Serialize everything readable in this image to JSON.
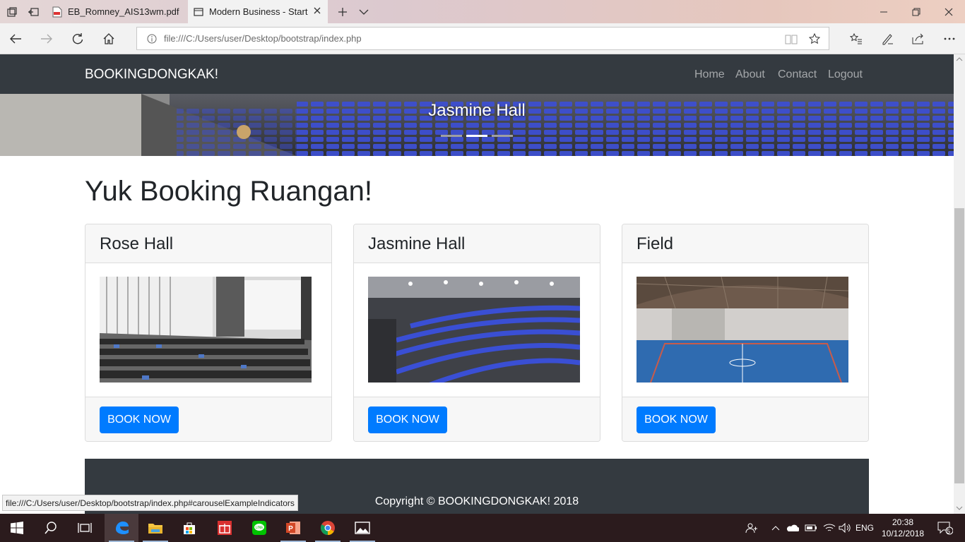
{
  "browser": {
    "tabs": [
      {
        "label": "EB_Romney_AIS13wm.pdf",
        "icon": "pdf-icon"
      },
      {
        "label": "Modern Business - Start",
        "icon": "page-icon",
        "active": true
      }
    ],
    "address": "file:///C:/Users/user/Desktop/bootstrap/index.php",
    "status_url": "file:///C:/Users/user/Desktop/bootstrap/index.php#carouselExampleIndicators"
  },
  "site": {
    "brand": "BOOKINGDONGKAK!",
    "nav": [
      "Home",
      "About",
      "Contact",
      "Logout"
    ],
    "carousel": {
      "caption": "Jasmine Hall",
      "active_index": 1,
      "count": 3
    },
    "heading": "Yuk Booking Ruangan!",
    "cards": [
      {
        "title": "Rose Hall",
        "button": "BOOK NOW"
      },
      {
        "title": "Jasmine Hall",
        "button": "BOOK NOW"
      },
      {
        "title": "Field",
        "button": "BOOK NOW"
      }
    ],
    "footer": "Copyright © BOOKINGDONGKAK! 2018"
  },
  "taskbar": {
    "language": "ENG",
    "time": "20:38",
    "date": "10/12/2018",
    "notifications": "5",
    "apps": [
      "windows-icon",
      "search-icon",
      "task-view-icon",
      "edge-icon",
      "file-explorer-icon",
      "store-icon",
      "gift-icon",
      "line-icon",
      "powerpoint-icon",
      "chrome-icon",
      "photos-icon"
    ]
  },
  "colors": {
    "navbar": "#343a40",
    "primary": "#007bff",
    "taskbar": "#2b1b1d"
  }
}
